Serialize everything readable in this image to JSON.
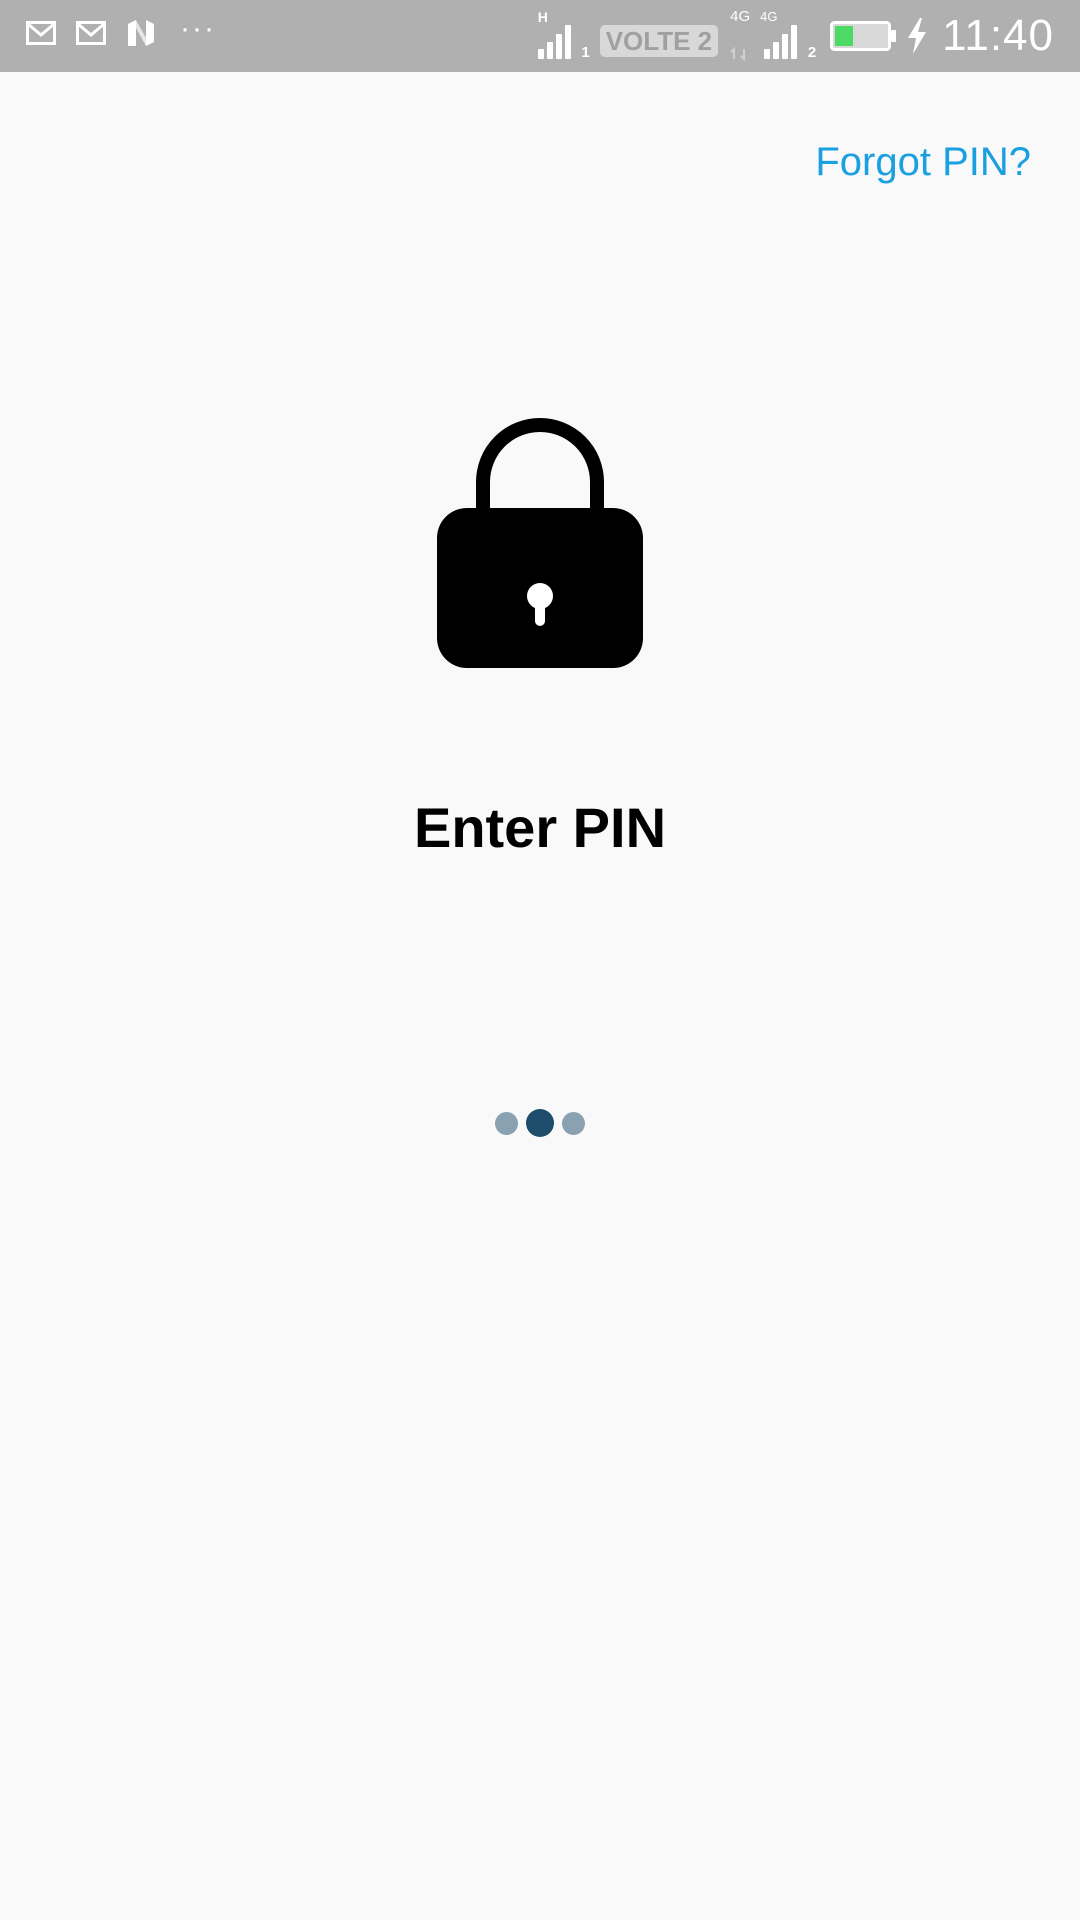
{
  "status_bar": {
    "notification_icons": [
      "gmail-icon",
      "gmail-icon",
      "n-app-icon"
    ],
    "overflow": "···",
    "sim1": {
      "network_type": "H",
      "slot": "1"
    },
    "volte": "VOLTE 2",
    "sim2": {
      "network_type_a": "4G",
      "network_type_b": "4G",
      "slot": "2"
    },
    "battery": {
      "level": 0.35,
      "charging": true,
      "fill_color": "#4cd964"
    },
    "time": "11:40"
  },
  "header": {
    "forgot_pin_label": "Forgot PIN?",
    "link_color": "#1aa0e0"
  },
  "main": {
    "icon": "lock-icon",
    "title": "Enter PIN",
    "pin_indicator": {
      "total_dots": 3,
      "active_dot": 2,
      "active_color": "#1d4d6a",
      "inactive_color": "#8aa1b1"
    }
  }
}
